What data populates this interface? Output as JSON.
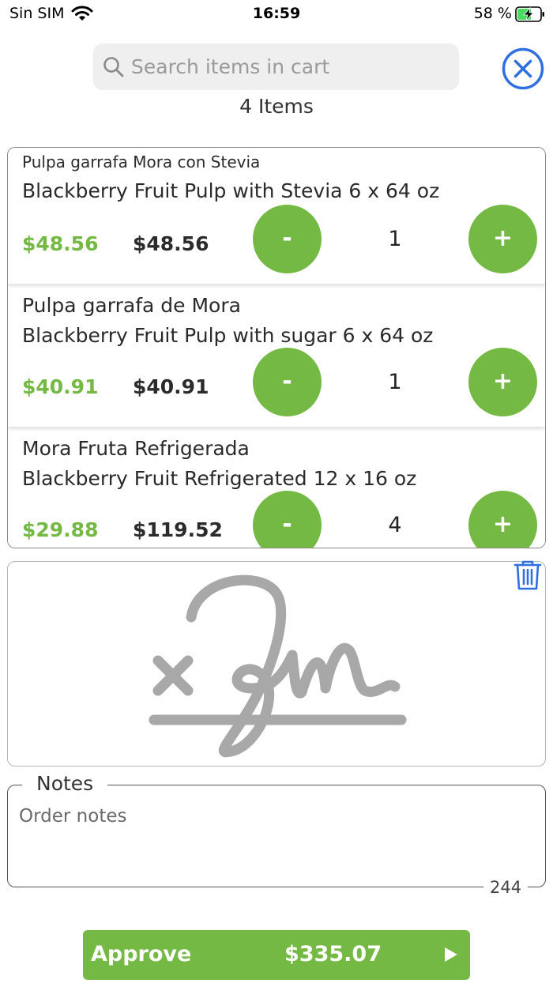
{
  "status_bar": {
    "carrier": "Sin SIM",
    "time": "16:59",
    "battery": "58 %"
  },
  "search": {
    "placeholder": "Search items in cart",
    "value": ""
  },
  "cart": {
    "count_label": "4 Items",
    "items": [
      {
        "name_es": "Pulpa garrafa Mora con Stevia",
        "name_en": "Blackberry Fruit Pulp with Stevia 6 x 64 oz",
        "unit_price": "$48.56",
        "total_price": "$48.56",
        "quantity": "1",
        "minus": "-",
        "plus": "+"
      },
      {
        "name_es": "Pulpa garrafa de Mora",
        "name_en": "Blackberry Fruit Pulp with sugar 6 x 64 oz",
        "unit_price": "$40.91",
        "total_price": "$40.91",
        "quantity": "1",
        "minus": "-",
        "plus": "+"
      },
      {
        "name_es": "Mora Fruta Refrigerada",
        "name_en": "Blackberry Fruit Refrigerated  12 x 16 oz",
        "unit_price": "$29.88",
        "total_price": "$119.52",
        "quantity": "4",
        "minus": "-",
        "plus": "+"
      }
    ]
  },
  "signature": {
    "icon": "signature-placeholder-icon",
    "clear_icon": "trash-icon"
  },
  "notes": {
    "label": "Notes",
    "placeholder": "Order notes",
    "value": "",
    "remaining_chars": "244"
  },
  "approve": {
    "label": "Approve",
    "total": "$335.07"
  },
  "colors": {
    "accent_green": "#74b944",
    "close_blue": "#2f6fe0",
    "signature_gray": "#a8a8a8"
  }
}
